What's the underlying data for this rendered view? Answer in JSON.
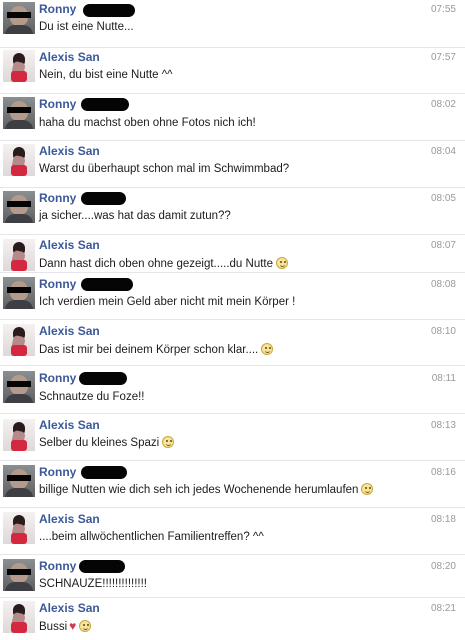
{
  "conversation": {
    "messages": [
      {
        "sender": "Ronny",
        "time": "07:55",
        "text": "Du ist eine Nutte...",
        "emoticon": false,
        "heart": false
      },
      {
        "sender": "Alexis San",
        "time": "07:57",
        "text": "Nein, du bist eine Nutte ^^",
        "emoticon": false,
        "heart": false
      },
      {
        "sender": "Ronny",
        "time": "08:02",
        "text": "haha du machst oben ohne Fotos nich ich!",
        "emoticon": false,
        "heart": false
      },
      {
        "sender": "Alexis San",
        "time": "08:04",
        "text": "Warst du überhaupt schon mal im Schwimmbad?",
        "emoticon": false,
        "heart": false
      },
      {
        "sender": "Ronny",
        "time": "08:05",
        "text": "ja sicher....was hat das damit zutun??",
        "emoticon": false,
        "heart": false
      },
      {
        "sender": "Alexis San",
        "time": "08:07",
        "text": "Dann hast dich oben ohne gezeigt.....du Nutte",
        "emoticon": true,
        "heart": false
      },
      {
        "sender": "Ronny",
        "time": "08:08",
        "text": "Ich verdien mein Geld aber nicht mit mein Körper !",
        "emoticon": false,
        "heart": false
      },
      {
        "sender": "Alexis San",
        "time": "08:10",
        "text": "Das ist mir bei deinem Körper schon klar....",
        "emoticon": true,
        "heart": false
      },
      {
        "sender": "Ronny",
        "time": "08:11",
        "text": "Schnautze du Foze!!",
        "emoticon": false,
        "heart": false
      },
      {
        "sender": "Alexis San",
        "time": "08:13",
        "text": "Selber du kleines Spazi",
        "emoticon": true,
        "heart": false
      },
      {
        "sender": "Ronny",
        "time": "08:16",
        "text": "billige Nutten wie dich seh ich jedes Wochenende herumlaufen",
        "emoticon": true,
        "heart": false
      },
      {
        "sender": "Alexis San",
        "time": "08:18",
        "text": "....beim allwöchentlichen Familientreffen? ^^",
        "emoticon": false,
        "heart": false
      },
      {
        "sender": "Ronny",
        "time": "08:20",
        "text": "SCHNAUZE!!!!!!!!!!!!!!",
        "emoticon": false,
        "heart": false
      },
      {
        "sender": "Alexis San",
        "time": "08:21",
        "text": "Bussi",
        "emoticon": true,
        "heart": true
      }
    ]
  },
  "colors": {
    "name": "#3b5998",
    "time": "#9a9a9a",
    "text": "#1c1c1c",
    "divider": "#e4e6ec"
  },
  "icons": {
    "ronny_avatar": "male-avatar-censored",
    "alexis_avatar": "female-avatar",
    "smiley": "smiley-emoticon",
    "heart": "heart-emoticon"
  }
}
